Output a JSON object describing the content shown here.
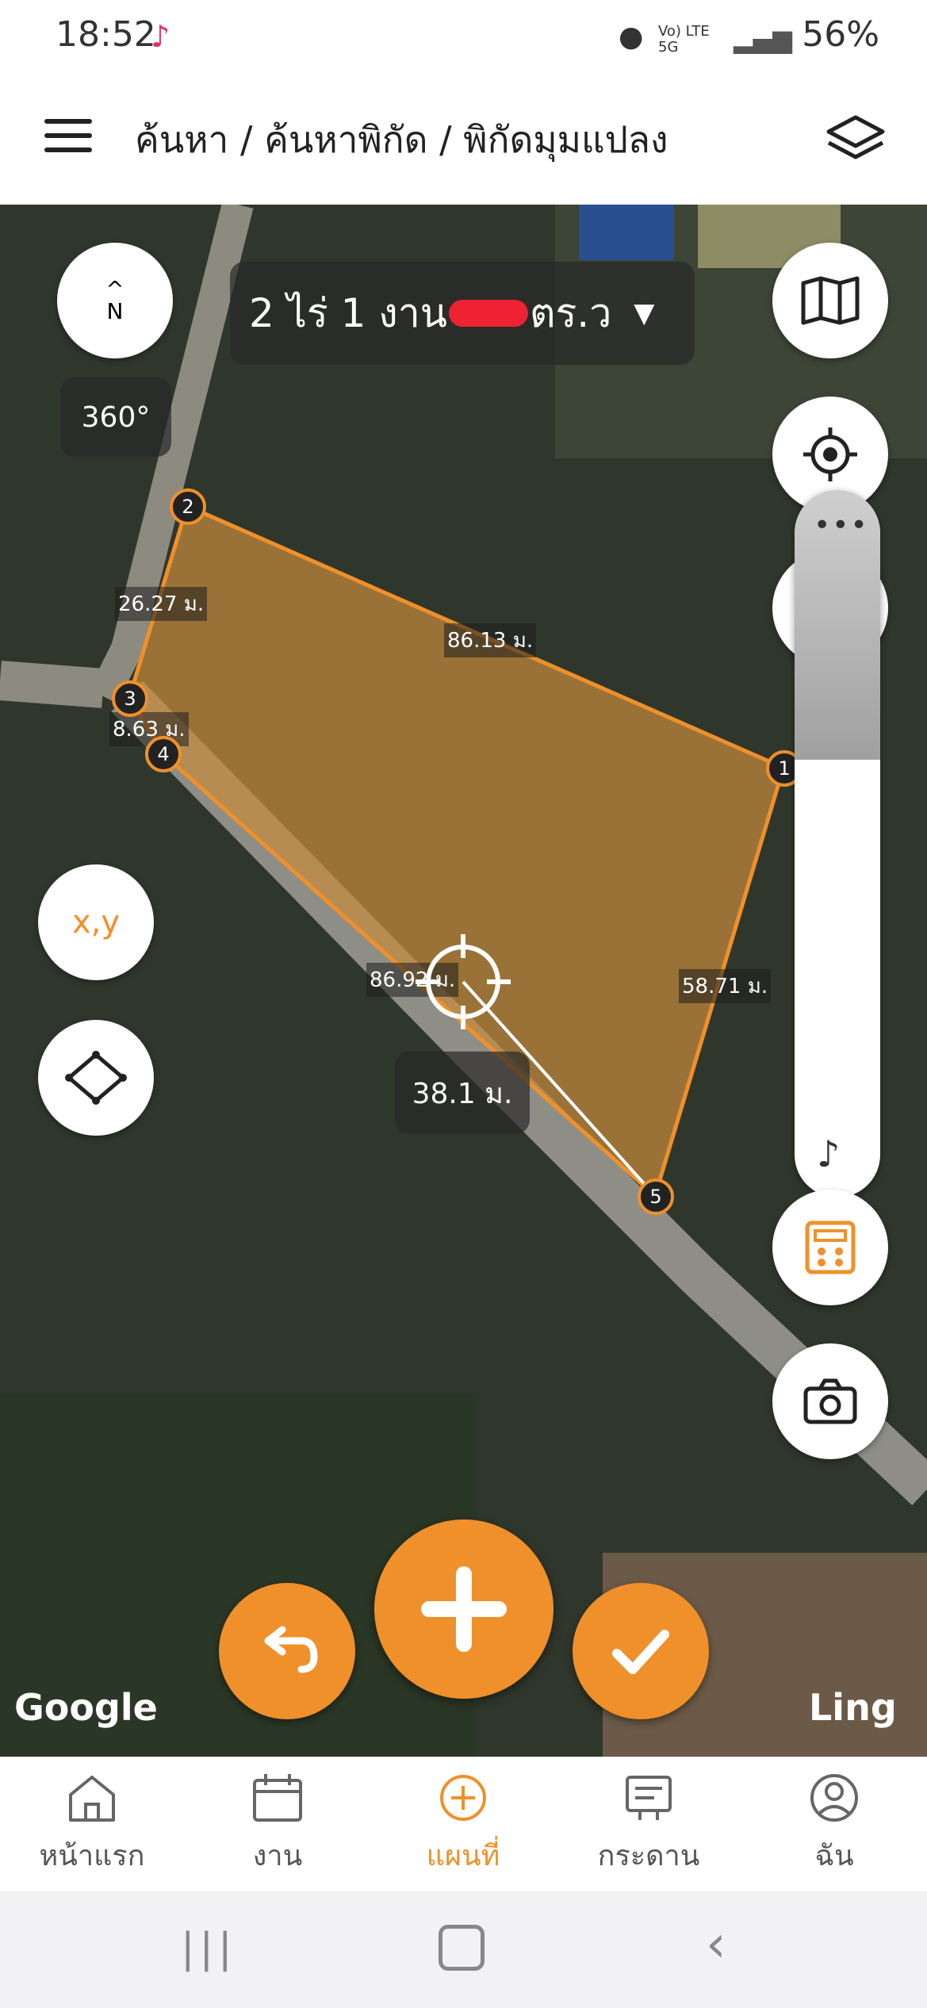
{
  "status_bar": {
    "time": "18:52",
    "network": "Vo) LTE 5G",
    "battery": "56%"
  },
  "header": {
    "breadcrumb": "ค้นหา / ค้นหาพิกัด / พิกัดมุมแปลง"
  },
  "map": {
    "area_label": "2 ไร่ 1 งาน ",
    "area_unit": "ตร.ว",
    "compass_label": "N",
    "rotation": "360°",
    "xy_button": "x,y",
    "measure_distance": "38.1 ม.",
    "edge_labels": [
      "26.27 ม.",
      "86.13 ม.",
      "8.63 ม.",
      "86.92 ม.",
      "58.71 ม."
    ],
    "vertices": [
      "1",
      "2",
      "3",
      "4",
      "5"
    ],
    "google_mark": "Google",
    "ling_mark": "Ling",
    "accent_color": "#f0902a"
  },
  "nav": {
    "items": [
      {
        "label": "หน้าแรก",
        "icon": "home-icon"
      },
      {
        "label": "งาน",
        "icon": "calendar-icon"
      },
      {
        "label": "แผนที่",
        "icon": "plus-circle-icon"
      },
      {
        "label": "กระดาน",
        "icon": "board-icon"
      },
      {
        "label": "ฉัน",
        "icon": "user-icon"
      }
    ]
  }
}
